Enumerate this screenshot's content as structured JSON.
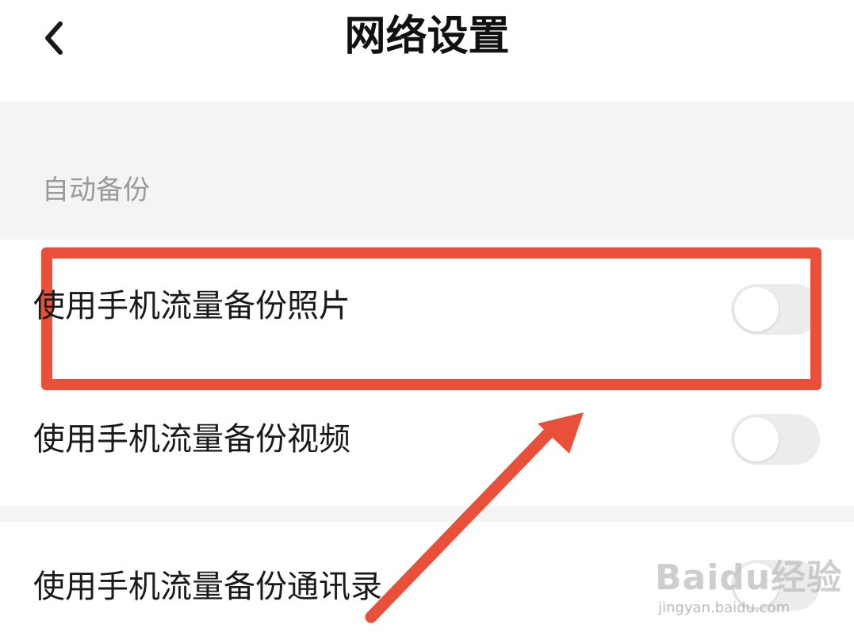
{
  "header": {
    "title": "网络设置",
    "back_icon": "chevron-left-icon"
  },
  "section": {
    "label": "自动备份"
  },
  "settings": [
    {
      "label": "使用手机流量备份照片",
      "toggle_on": false
    },
    {
      "label": "使用手机流量备份视频",
      "toggle_on": false
    },
    {
      "label": "使用手机流量备份通讯录",
      "toggle_on": false
    }
  ],
  "annotation": {
    "highlight_color": "#e8503a",
    "arrow_color": "#e8503a"
  },
  "watermark": {
    "logo": "Baidu经验",
    "url": "jingyan.baidu.com"
  }
}
